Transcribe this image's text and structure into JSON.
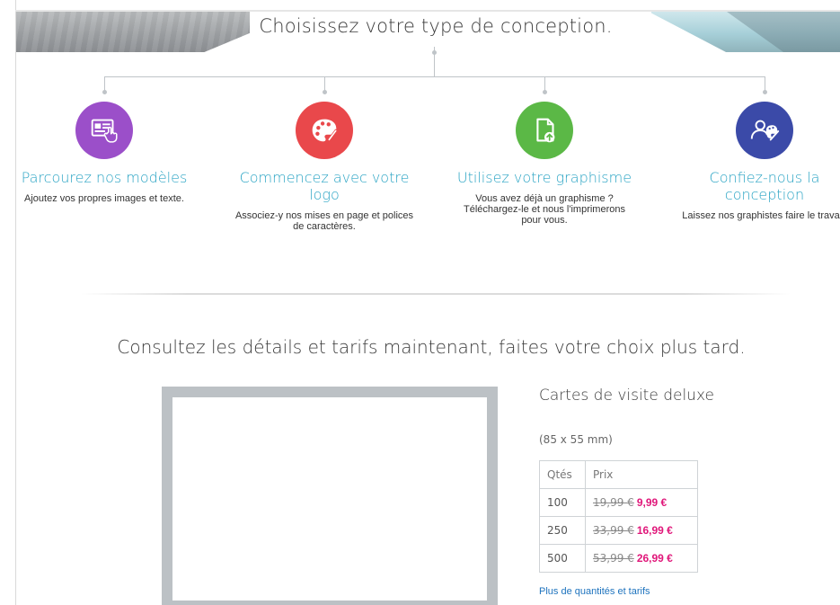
{
  "design": {
    "title": "Choisissez votre type de conception.",
    "options": [
      {
        "title": "Parcourez nos modèles",
        "description": "Ajoutez vos propres images et texte.",
        "icon": "template-browse-icon",
        "color": "#9b4fc9"
      },
      {
        "title": "Commencez avec votre logo",
        "description": "Associez-y nos mises en page et polices de caractères.",
        "icon": "palette-icon",
        "color": "#e9484b"
      },
      {
        "title": "Utilisez votre graphisme",
        "description": "Vous avez déjà un graphisme ? Téléchargez-le et nous l'imprimerons pour vous.",
        "icon": "upload-file-icon",
        "color": "#5bb846"
      },
      {
        "title": "Confiez-nous la conception",
        "description": "Laissez nos graphistes faire le travail.",
        "icon": "designer-icon",
        "color": "#3b4aa8"
      }
    ]
  },
  "pricing": {
    "heading": "Consultez les détails et tarifs maintenant, faites votre choix plus tard.",
    "product_name": "Cartes de visite deluxe",
    "product_size": "(85 x 55 mm)",
    "table_headers": {
      "qty": "Qtés",
      "price": "Prix"
    },
    "rows": [
      {
        "qty": "100",
        "old_price": "19,99 €",
        "new_price": "9,99 €"
      },
      {
        "qty": "250",
        "old_price": "33,99 €",
        "new_price": "16,99 €"
      },
      {
        "qty": "500",
        "old_price": "53,99 €",
        "new_price": "26,99 €"
      }
    ],
    "more_link": "Plus de quantités et tarifs"
  },
  "colors": {
    "accent_title": "#2aa4c4",
    "sale_price": "#e0177a",
    "link": "#1e73be"
  }
}
